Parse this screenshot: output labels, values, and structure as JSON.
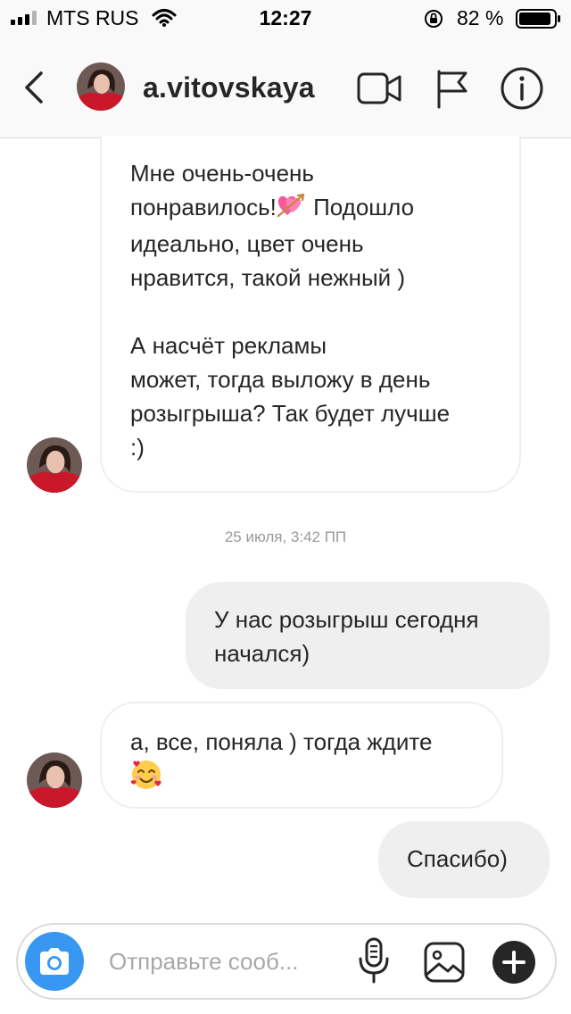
{
  "status_bar": {
    "carrier": "MTS RUS",
    "time": "12:27",
    "battery": "82 %"
  },
  "header": {
    "username": "a.vitovskaya",
    "icons": [
      "back-chevron-icon",
      "video-call-icon",
      "flag-icon",
      "info-icon"
    ]
  },
  "messages": [
    {
      "direction": "incoming",
      "text_1": "Мне очень-очень\nпонравилось!",
      "emoji_1": "heart-with-arrow",
      "text_2": " Подошло\nидеально, цвет очень\nнравится, такой нежный )\n\nА насчёт рекламы\nможет, тогда выложу в день\nрозыгрыша? Так будет лучше\n:)"
    },
    {
      "direction": "outgoing",
      "text": "У нас розыгрыш сегодня\nначался)"
    },
    {
      "direction": "incoming",
      "text": "а, все, поняла ) тогда ждите\n",
      "emoji": "smiling-face-with-hearts"
    },
    {
      "direction": "outgoing",
      "text": "Спасибо)"
    }
  ],
  "timestamp": "25 июля, 3:42 ПП",
  "composer": {
    "placeholder": "Отправьте сооб...",
    "icons": [
      "camera-icon",
      "microphone-icon",
      "gallery-icon",
      "plus-icon"
    ]
  },
  "colors": {
    "accent": "#3897f0",
    "incoming_bubble_border": "#efefef",
    "outgoing_bubble": "#efefef",
    "text": "#262626"
  }
}
